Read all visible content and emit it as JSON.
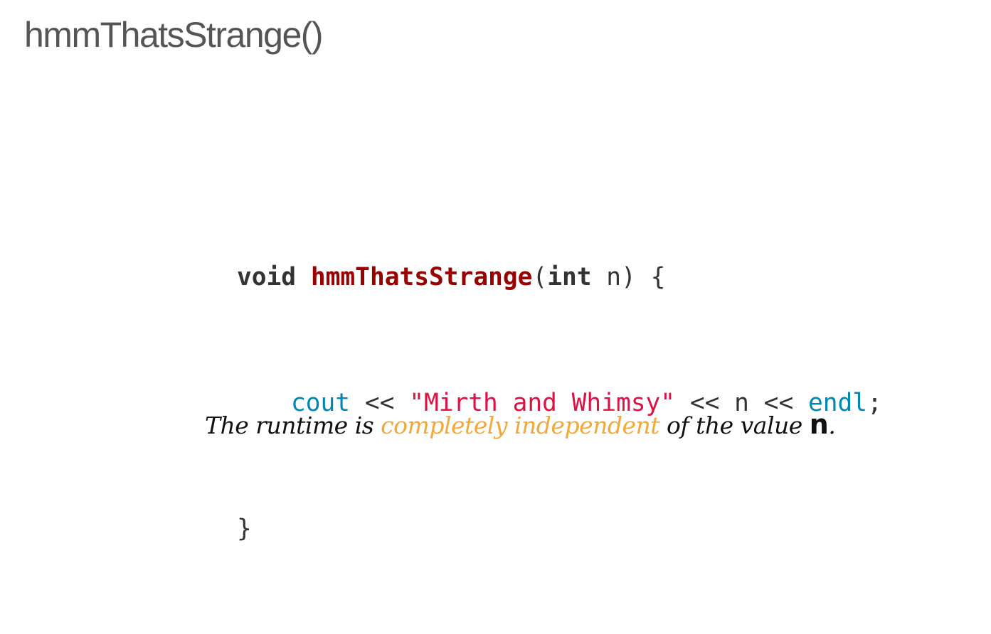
{
  "slide": {
    "title": "hmmThatsStrange()"
  },
  "code": {
    "line1": {
      "keyword_void": "void",
      "function_name": "hmmThatsStrange",
      "open_paren": "(",
      "keyword_int": "int",
      "params_rest": " n) {"
    },
    "line2": {
      "cout": "cout",
      "op1": " << ",
      "string_literal": "\"Mirth and Whimsy\"",
      "middle": " << n << ",
      "endl": "endl",
      "semicolon": ";"
    },
    "line3": {
      "close_brace": "}"
    }
  },
  "caption": {
    "prefix": "The runtime is ",
    "highlight": "completely independent",
    "middle": " of the value ",
    "variable": "n",
    "suffix": "."
  },
  "colors": {
    "title": "#555555",
    "function_name": "#990000",
    "builtin": "#0086b3",
    "string": "#dd1144",
    "highlight": "#f2a93b"
  }
}
